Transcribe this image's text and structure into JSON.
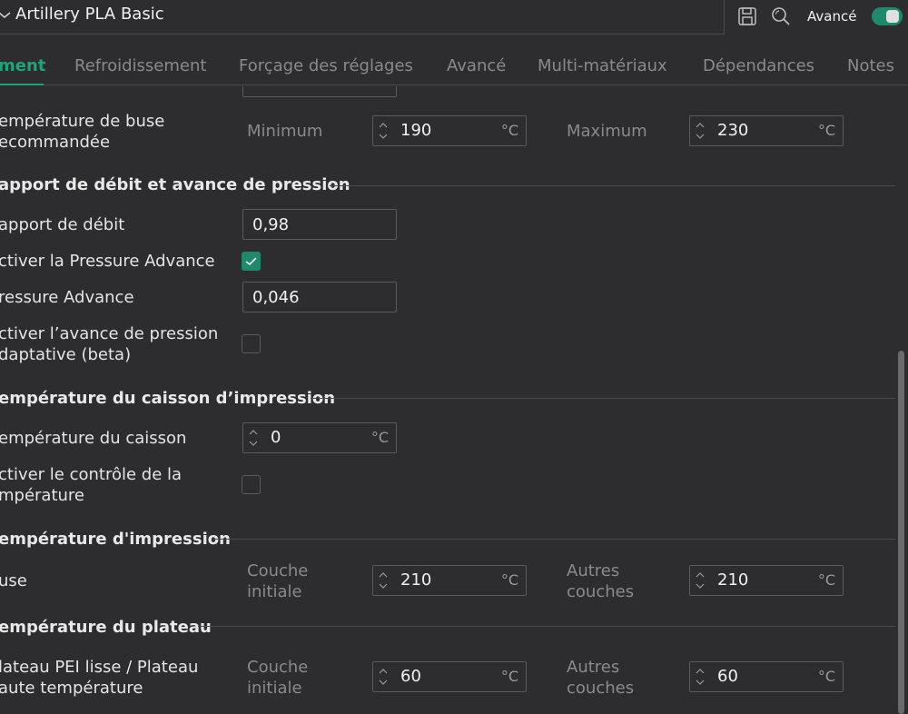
{
  "header": {
    "preset_name": "Artillery PLA Basic",
    "advanced_label": "Avancé",
    "advanced_on": true,
    "accent": "#1f8a6b"
  },
  "tabs": [
    {
      "label": "ment",
      "active": true
    },
    {
      "label": "Refroidissement"
    },
    {
      "label": "Forçage des réglages"
    },
    {
      "label": "Avancé"
    },
    {
      "label": "Multi-matériaux"
    },
    {
      "label": "Dépendances"
    },
    {
      "label": "Notes"
    }
  ],
  "nozzle_range": {
    "label_1": "empérature de buse",
    "label_2": "ecommandée",
    "min_label": "Minimum",
    "min_value": "190",
    "max_label": "Maximum",
    "max_value": "230",
    "unit": "°C"
  },
  "flow_section": {
    "title": "apport de débit et avance de pression",
    "flow_ratio_label": "apport de débit",
    "flow_ratio_value": "0,98",
    "enable_pa_label": "ctiver la Pressure Advance",
    "enable_pa_checked": true,
    "pa_label": "ressure Advance",
    "pa_value": "0,046",
    "adaptive_label_1": "ctiver l’avance de pression",
    "adaptive_label_2": "daptative (beta)",
    "adaptive_checked": false
  },
  "chamber_section": {
    "title": "empérature du caisson d’impression",
    "chamber_temp_label": "empérature du caisson",
    "chamber_temp_value": "0",
    "unit": "°C",
    "activate_label_1": "ctiver le contrôle de la",
    "activate_label_2": "mpérature",
    "activate_checked": false
  },
  "print_temp_section": {
    "title": "empérature d'impression",
    "nozzle_label": "use",
    "initial_label_1": "Couche",
    "initial_label_2": "initiale",
    "initial_value": "210",
    "other_label_1": "Autres",
    "other_label_2": "couches",
    "other_value": "210",
    "unit": "°C"
  },
  "bed_section": {
    "title": "empérature du plateau",
    "plate_label_1": "lateau PEI lisse / Plateau",
    "plate_label_2": "aute température",
    "initial_label_1": "Couche",
    "initial_label_2": "initiale",
    "initial_value": "60",
    "other_label_1": "Autres",
    "other_label_2": "couches",
    "other_value": "60",
    "unit": "°C"
  }
}
